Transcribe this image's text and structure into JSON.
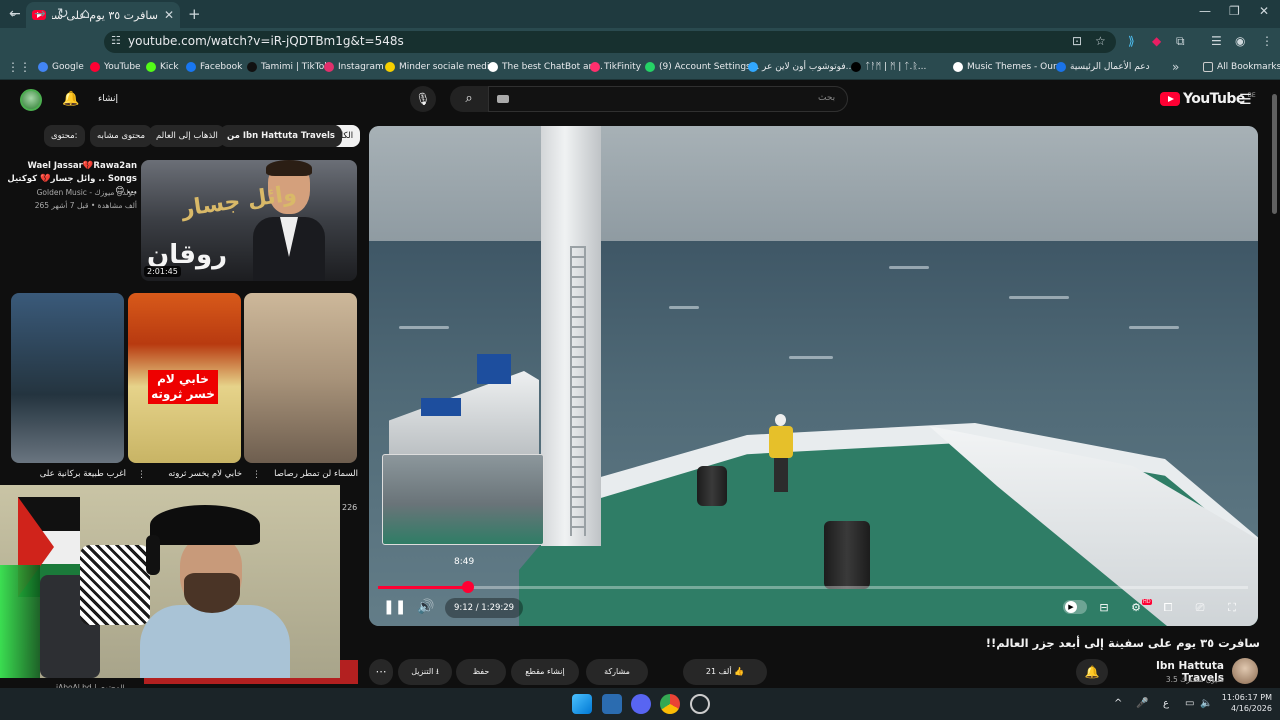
{
  "browser": {
    "tab_title": "سافرت ٣٥ يوم على سفينة إل...",
    "url": "youtube.com/watch?v=iR-jQDTBm1g&t=548s",
    "bookmarks": [
      {
        "label": "Google",
        "color": "#4285f4"
      },
      {
        "label": "YouTube",
        "color": "#ff0033"
      },
      {
        "label": "Kick",
        "color": "#53fc18"
      },
      {
        "label": "Facebook",
        "color": "#1877f2"
      },
      {
        "label": "Tamimi | TikTok",
        "color": "#111111"
      },
      {
        "label": "Instagram",
        "color": "#e1306c"
      },
      {
        "label": "Minder sociale medi...",
        "color": "#f5d000"
      },
      {
        "label": "The best ChatBot an...",
        "color": "#ffffff"
      },
      {
        "label": "TikFinity",
        "color": "#ff2f6d"
      },
      {
        "label": "(9) Account Settings...",
        "color": "#25d366"
      },
      {
        "label": "فوتوشوب أون لاين عر...",
        "color": "#31a8ff"
      },
      {
        "label": "ᛏᚨᛗ | ᛗ | ᛏ.ᚱ...",
        "color": "#000000"
      },
      {
        "label": "Music Themes - Our...",
        "color": "#ffffff"
      },
      {
        "label": "دعم الأعمال الرئيسية",
        "color": "#1a73e8"
      }
    ],
    "all_bookmarks": "All Bookmarks"
  },
  "yt": {
    "create_label": "إنشاء",
    "search_placeholder": "بحث",
    "logo_text": "YouTube",
    "logo_region": "BE"
  },
  "chips": [
    {
      "label": "الكل",
      "active": true
    },
    {
      "label": "من Ibn Hattuta Travels",
      "active": false
    },
    {
      "label": "الذهاب إلى العالم",
      "active": false
    },
    {
      "label": "محتوى مشابه",
      "active": false
    },
    {
      "label": "محتوى:",
      "active": false
    }
  ],
  "sidebar": {
    "video": {
      "title_line1": "Wael Jassar💔Rawa2an",
      "title_line2": "وائل جسار💔 كوكتيل .. Songs 😊 ...",
      "channel": "Golden Music - جولدن ميوزك",
      "meta": "265 ألف مشاهدة • قبل 7 أشهر",
      "duration": "2:01:45",
      "thumb_text_1": "وائل جسار",
      "thumb_text_2": "روقان"
    },
    "shorts": [
      {
        "title": "أغرب طبيعة بركانية على"
      },
      {
        "title": "خابي لام يخسر ثروته"
      },
      {
        "title": "السماء لن تمطر رصاصاً"
      }
    ],
    "short_caption": "خابي لام خسر ثروته",
    "below_webcam_meta": "iAboAl.bd | المحتوى",
    "side_count": "226"
  },
  "player": {
    "current_time": "9:12",
    "total_time": "1:29:29",
    "time_display": "9:12 / 1:29:29",
    "hover_time": "8:49",
    "progress_fraction": 0.103,
    "hover_fraction": 0.099
  },
  "video": {
    "title": "سافرت ٣٥ يوم على سفينة إلى أبعد جزر العالم!!",
    "channel": "Ibn Hattuta Travels",
    "subscribers": "3.5 مليون مشترك",
    "likes": "21 ألف",
    "share": "مشاركة",
    "clip": "إنشاء مقطع",
    "save": "حفظ",
    "download": "التنزيل"
  },
  "taskbar": {
    "time": "11:06:17 PM",
    "date": "4/16/2026",
    "lang": "ع"
  }
}
